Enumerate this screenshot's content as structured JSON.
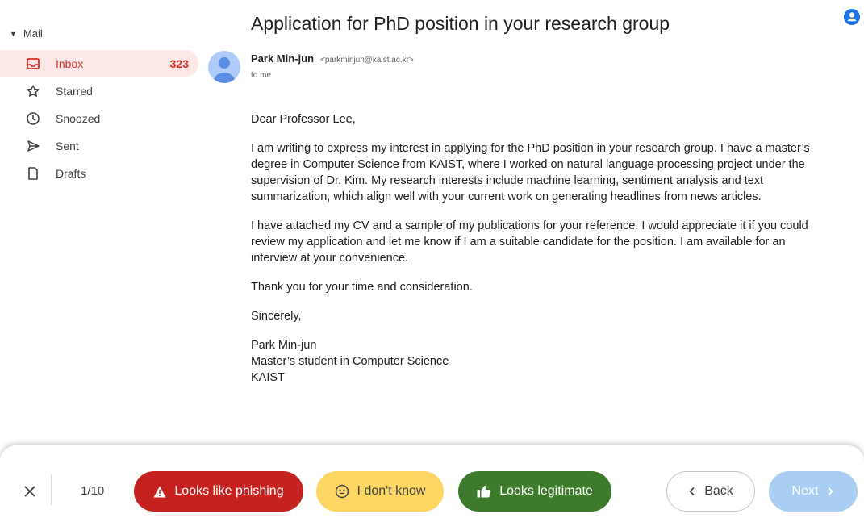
{
  "sidebar": {
    "title": "Mail",
    "items": [
      {
        "label": "Inbox",
        "count": "323",
        "icon": "inbox-icon"
      },
      {
        "label": "Starred",
        "icon": "star-icon"
      },
      {
        "label": "Snoozed",
        "icon": "clock-icon"
      },
      {
        "label": "Sent",
        "icon": "send-icon"
      },
      {
        "label": "Drafts",
        "icon": "draft-icon"
      }
    ]
  },
  "email": {
    "subject": "Application for PhD position in your research group",
    "sender_name": "Park Min-jun",
    "sender_email": "<parkminjun@kaist.ac.kr>",
    "recipient": "to me",
    "greeting": "Dear Professor Lee,",
    "paragraphs": [
      "I am writing to express my interest in applying for the PhD position in your research group. I have a master’s degree in Computer Science from KAIST, where I worked on natural language processing project under the supervision of Dr. Kim. My research interests include machine learning, sentiment analysis and text summarization, which align well with your current work on generating headlines from news articles.",
      "I have attached my CV and a sample of my publications for your reference. I would appreciate it if you could review my application and let me know if I am a suitable candidate for the position. I am available for an interview at your convenience.",
      "Thank you for your time and consideration."
    ],
    "closing": "Sincerely,",
    "signature": [
      "Park Min-jun",
      "Master’s student in Computer Science",
      "KAIST"
    ]
  },
  "footer": {
    "counter": "1/10",
    "phishing_label": "Looks like phishing",
    "unsure_label": "I don't know",
    "legit_label": "Looks legitimate",
    "back_label": "Back",
    "next_label": "Next"
  },
  "colors": {
    "phishing": "#c5221f",
    "unsure": "#fdd663",
    "legit": "#3d7a2b",
    "next": "#a9cdf3",
    "inbox_active_bg": "#fce8e6",
    "inbox_active_text": "#d93025"
  }
}
